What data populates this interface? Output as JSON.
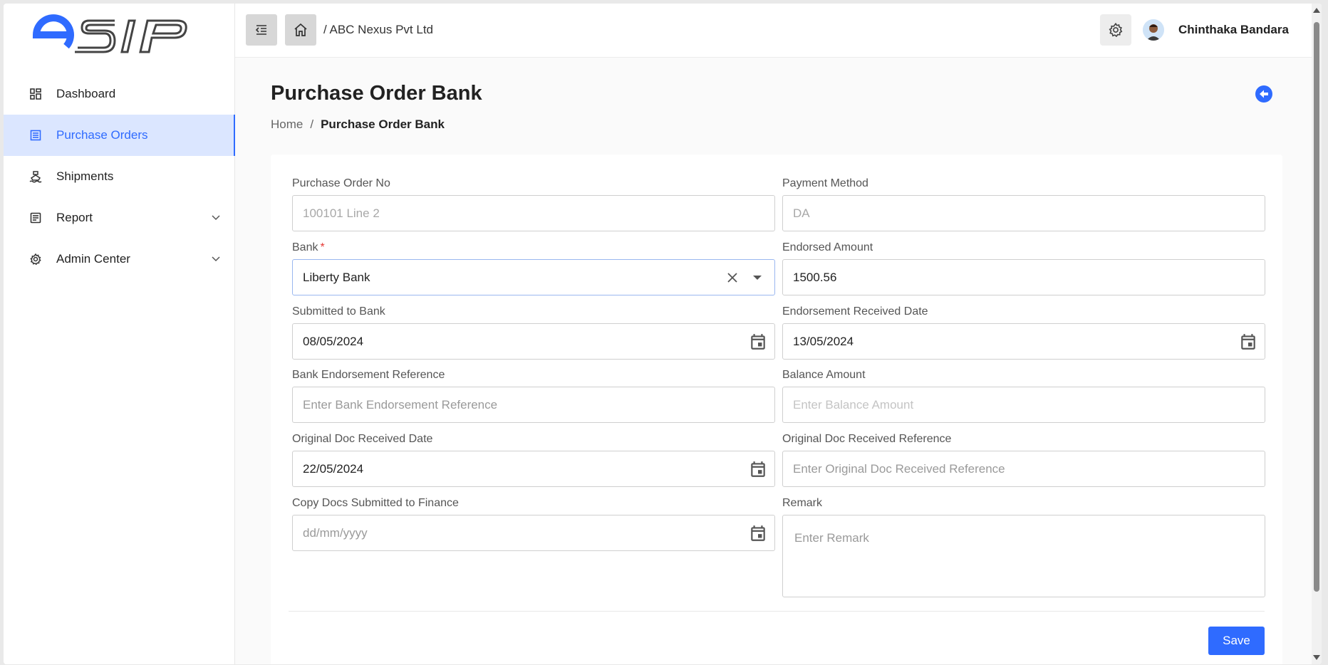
{
  "brand": {
    "logo_text": "esip",
    "accent": "#2f6bff"
  },
  "sidebar": {
    "items": [
      {
        "label": "Dashboard",
        "icon": "dashboard-icon"
      },
      {
        "label": "Purchase Orders",
        "icon": "list-icon",
        "active": true
      },
      {
        "label": "Shipments",
        "icon": "ship-icon"
      },
      {
        "label": "Report",
        "icon": "report-icon",
        "expandable": true
      },
      {
        "label": "Admin Center",
        "icon": "gear-icon",
        "expandable": true
      }
    ]
  },
  "topbar": {
    "breadcrumb": "/ ABC Nexus Pvt Ltd",
    "user_name": "Chinthaka Bandara"
  },
  "page": {
    "title": "Purchase Order Bank",
    "breadcrumb_home": "Home",
    "breadcrumb_sep": "/",
    "breadcrumb_current": "Purchase Order Bank"
  },
  "form": {
    "po_no": {
      "label": "Purchase Order No",
      "value": "100101 Line 2"
    },
    "payment_method": {
      "label": "Payment Method",
      "value": "DA"
    },
    "bank": {
      "label": "Bank",
      "required": "*",
      "value": "Liberty Bank"
    },
    "endorsed_amount": {
      "label": "Endorsed Amount",
      "value": "1500.56"
    },
    "submitted_to_bank": {
      "label": "Submitted to Bank",
      "value": "08/05/2024"
    },
    "endorsement_received_date": {
      "label": "Endorsement Received Date",
      "value": "13/05/2024"
    },
    "bank_endorsement_reference": {
      "label": "Bank Endorsement Reference",
      "placeholder": "Enter Bank Endorsement Reference"
    },
    "balance_amount": {
      "label": "Balance Amount",
      "placeholder": "Enter Balance Amount"
    },
    "original_doc_received_date": {
      "label": "Original Doc Received Date",
      "value": "22/05/2024"
    },
    "original_doc_received_reference": {
      "label": "Original Doc Received Reference",
      "placeholder": "Enter Original Doc Received Reference"
    },
    "copy_docs_submitted": {
      "label": "Copy Docs Submitted to Finance",
      "placeholder": "dd/mm/yyyy"
    },
    "remark": {
      "label": "Remark",
      "placeholder": "Enter Remark"
    },
    "save_label": "Save"
  }
}
